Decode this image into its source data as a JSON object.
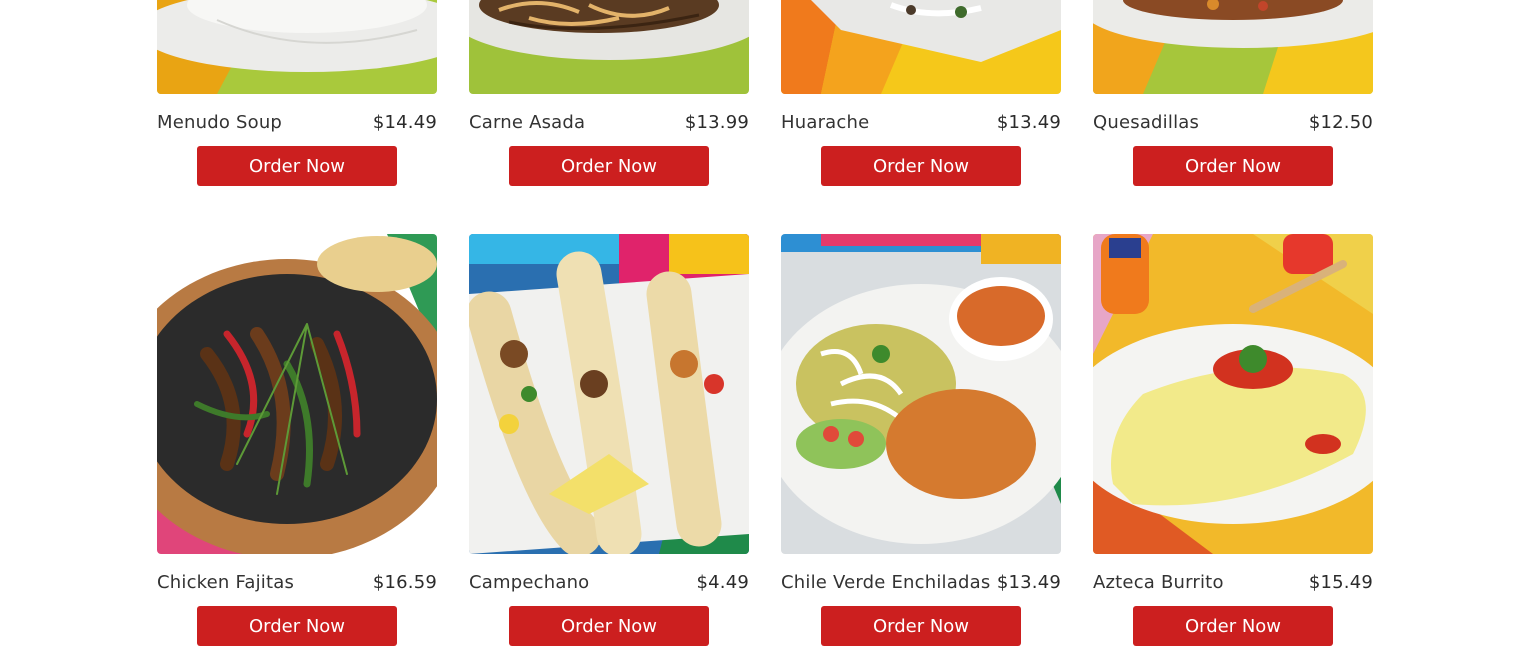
{
  "menu": {
    "items": [
      {
        "name": "Menudo Soup",
        "price": "$14.49",
        "button_label": "Order Now"
      },
      {
        "name": "Carne Asada",
        "price": "$13.99",
        "button_label": "Order Now"
      },
      {
        "name": "Huarache",
        "price": "$13.49",
        "button_label": "Order Now"
      },
      {
        "name": "Quesadillas",
        "price": "$12.50",
        "button_label": "Order Now"
      },
      {
        "name": "Chicken Fajitas",
        "price": "$16.59",
        "button_label": "Order Now"
      },
      {
        "name": "Campechano",
        "price": "$4.49",
        "button_label": "Order Now"
      },
      {
        "name": "Chile Verde Enchiladas",
        "price": "$13.49",
        "button_label": "Order Now"
      },
      {
        "name": "Azteca Burrito",
        "price": "$15.49",
        "button_label": "Order Now"
      }
    ]
  },
  "colors": {
    "button_bg": "#cc1f1f",
    "button_text": "#ffffff",
    "text": "#333333"
  }
}
